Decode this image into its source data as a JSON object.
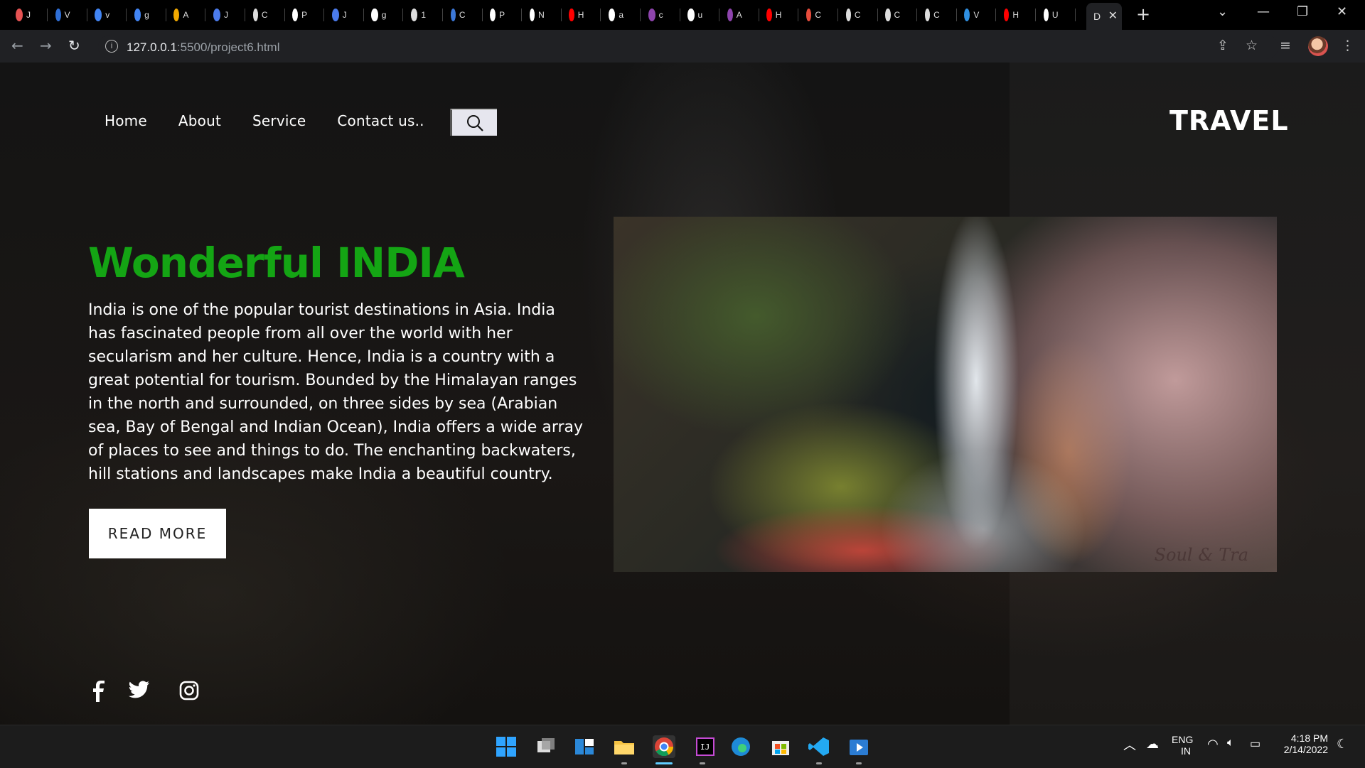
{
  "browser": {
    "tabs": [
      {
        "label": "J",
        "color": "#e55353"
      },
      {
        "label": "V",
        "color": "#2f6fd6"
      },
      {
        "label": "v",
        "color": "#4285f4"
      },
      {
        "label": "g",
        "color": "#4285f4"
      },
      {
        "label": "A",
        "color": "#f2a900"
      },
      {
        "label": "J",
        "color": "#4b7bec"
      },
      {
        "label": "C",
        "color": "#dddddd"
      },
      {
        "label": "P",
        "color": "#ffffff"
      },
      {
        "label": "J",
        "color": "#4b7bec"
      },
      {
        "label": "g",
        "color": "#ffffff"
      },
      {
        "label": "1",
        "color": "#dddddd"
      },
      {
        "label": "C",
        "color": "#3c78d8"
      },
      {
        "label": "P",
        "color": "#ffffff"
      },
      {
        "label": "N",
        "color": "#ffffff"
      },
      {
        "label": "H",
        "color": "#ff0000"
      },
      {
        "label": "a",
        "color": "#ffffff"
      },
      {
        "label": "c",
        "color": "#8e44ad"
      },
      {
        "label": "u",
        "color": "#ffffff"
      },
      {
        "label": "A",
        "color": "#8e44ad"
      },
      {
        "label": "H",
        "color": "#ff0000"
      },
      {
        "label": "C",
        "color": "#e74c3c"
      },
      {
        "label": "C",
        "color": "#dddddd"
      },
      {
        "label": "C",
        "color": "#dddddd"
      },
      {
        "label": "C",
        "color": "#dddddd"
      },
      {
        "label": "V",
        "color": "#2f8fe0"
      },
      {
        "label": "H",
        "color": "#ff0000"
      },
      {
        "label": "U",
        "color": "#ffffff"
      }
    ],
    "active_tab_label": "D",
    "url_host": "127.0.0.1",
    "url_path": ":5500/project6.html"
  },
  "nav": {
    "items": [
      "Home",
      "About",
      "Service",
      "Contact us.."
    ],
    "logo": "TRAVEL"
  },
  "hero": {
    "title": "Wonderful INDIA",
    "text": "India is one of the popular tourist destinations in Asia. India has fascinated people from all over the world with her secularism and her culture. Hence, India is a country with a great potential for tourism. Bounded by the Himalayan ranges in the north and surrounded, on three sides by sea (Arabian sea, Bay of Bengal and Indian Ocean), India offers a wide array of places to see and things to do. The enchanting backwaters, hill stations and landscapes make India a beautiful country.",
    "button": "READ MORE",
    "image_watermark": "Soul & Tra"
  },
  "colors": {
    "title_green": "#14a514",
    "page_bg": "#121212"
  },
  "social": [
    "facebook-icon",
    "twitter-icon",
    "instagram-icon"
  ],
  "taskbar": {
    "lang_top": "ENG",
    "lang_bottom": "IN",
    "time": "4:18 PM",
    "date": "2/14/2022"
  }
}
